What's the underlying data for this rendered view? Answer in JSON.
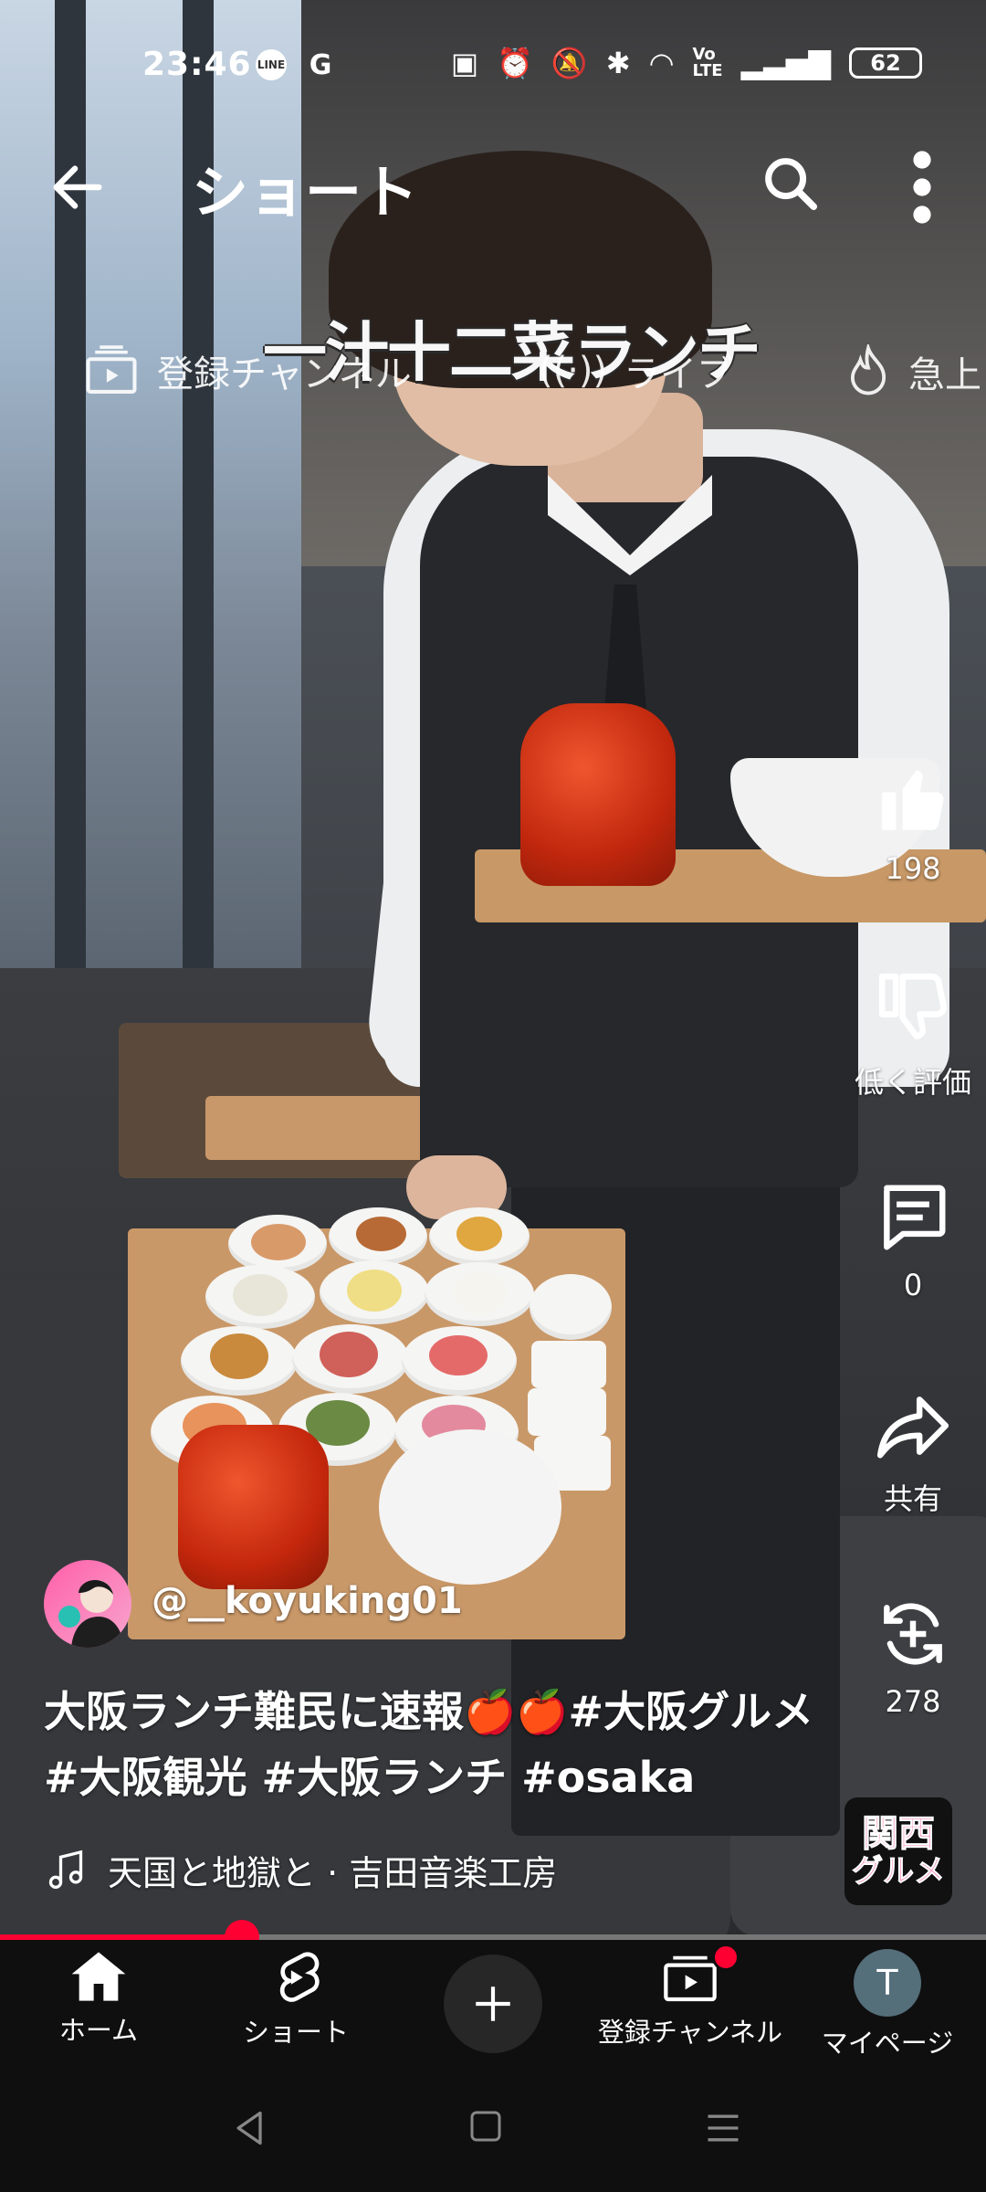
{
  "status_bar": {
    "time": "23:46",
    "apps": [
      "LINE",
      "G"
    ],
    "battery": "62"
  },
  "header": {
    "title": "ショート"
  },
  "channel_strip": {
    "items": [
      "登録チャンネル",
      "ライブ",
      "急上"
    ]
  },
  "video": {
    "overlay_caption": "一汁十二菜ランチ",
    "badge_line1": "関西",
    "badge_line2": "グルメ",
    "progress_fraction": 0.245
  },
  "rail": {
    "like_count": "198",
    "dislike_label": "低く評価",
    "comment_count": "0",
    "share_label": "共有",
    "remix_count": "278"
  },
  "channel": {
    "handle": "@__koyuking01",
    "description": "大阪ランチ難民に速報🍎🍎#大阪グルメ #大阪観光 #大阪ランチ #osaka",
    "music": "天国と地獄と · 吉田音楽工房"
  },
  "bottom_nav": {
    "home": "ホーム",
    "shorts": "ショート",
    "subscriptions": "登録チャンネル",
    "mypage": "マイページ",
    "user_initial": "T"
  },
  "colors": {
    "accent": "#ff0033",
    "nav_bg": "#0f0f0f"
  }
}
